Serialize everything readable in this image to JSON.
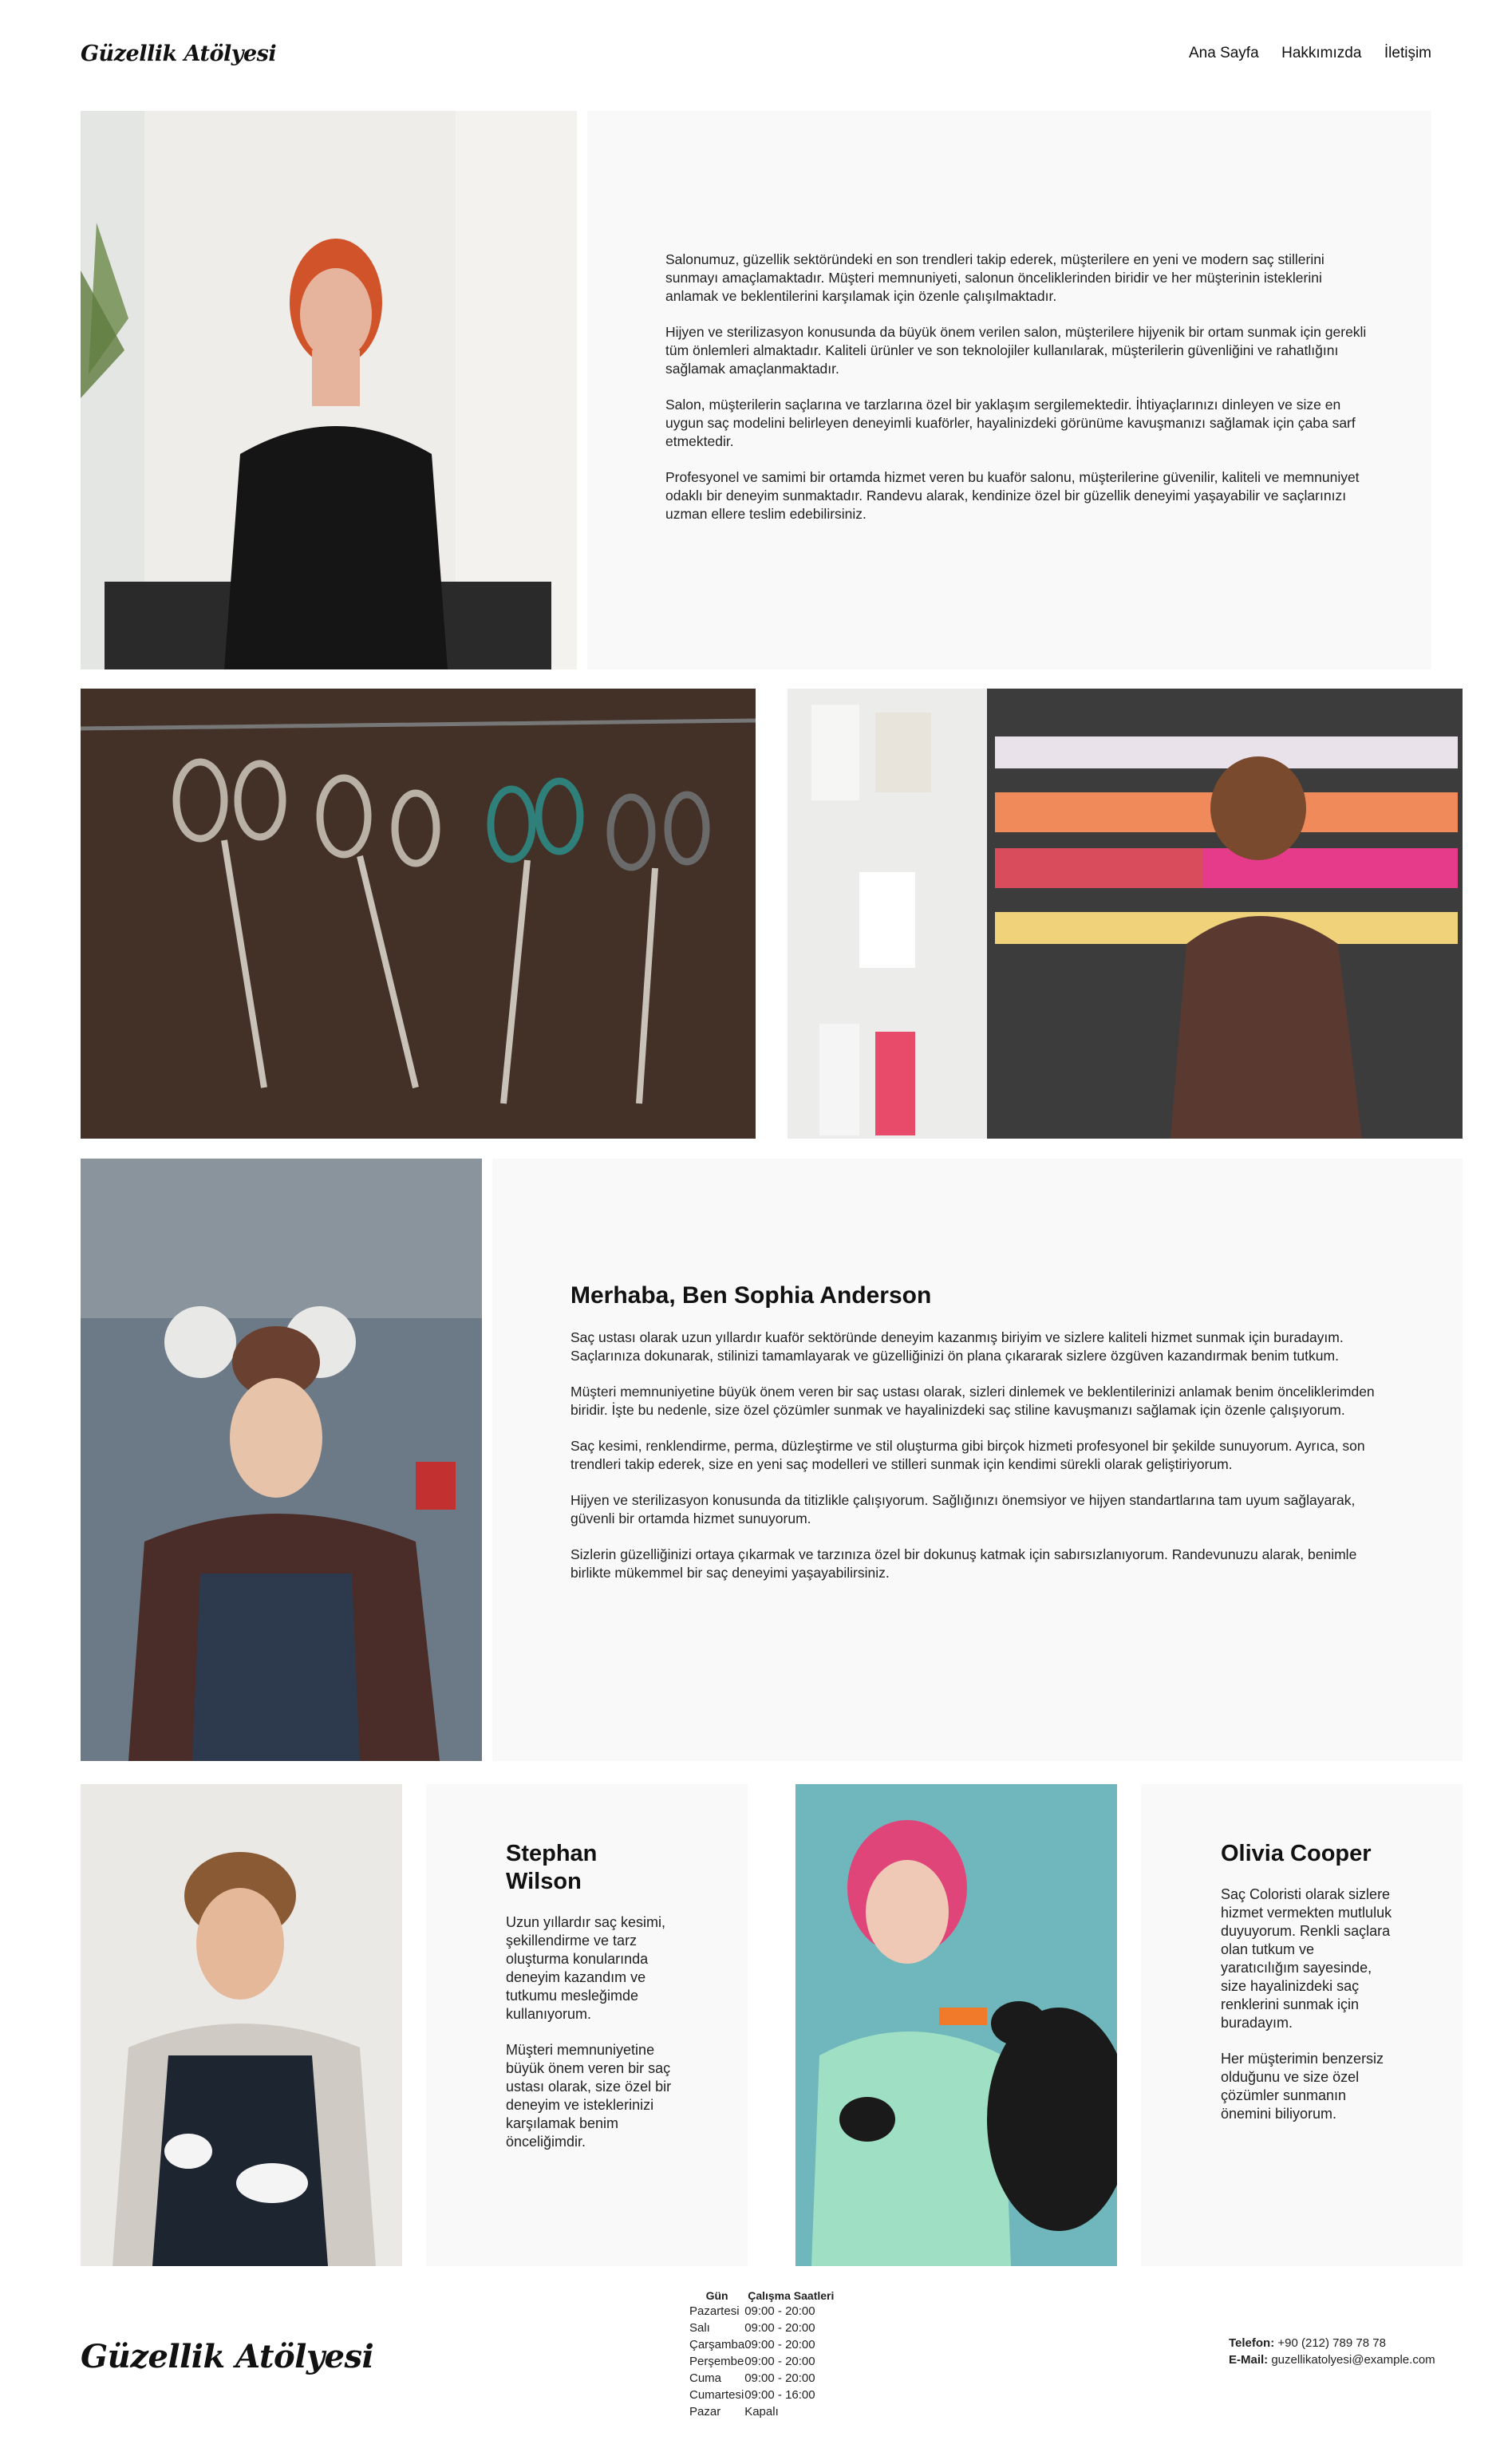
{
  "brand": {
    "name": "Güzellik Atölyesi"
  },
  "nav": {
    "home": "Ana Sayfa",
    "about": "Hakkımızda",
    "contact": "İletişim"
  },
  "intro": {
    "paragraphs": [
      "Salonumuz, güzellik sektöründeki en son trendleri takip ederek, müşterilere en yeni ve modern saç stillerini sunmayı amaçlamaktadır. Müşteri memnuniyeti, salonun önceliklerinden biridir ve her müşterinin isteklerini anlamak ve beklentilerini karşılamak için özenle çalışılmaktadır.",
      "Hijyen ve sterilizasyon konusunda da büyük önem verilen salon, müşterilere hijyenik bir ortam sunmak için gerekli tüm önlemleri almaktadır. Kaliteli ürünler ve son teknolojiler kullanılarak, müşterilerin güvenliğini ve rahatlığını sağlamak amaçlanmaktadır.",
      "Salon, müşterilerin saçlarına ve tarzlarına özel bir yaklaşım sergilemektedir. İhtiyaçlarınızı dinleyen ve size en uygun saç modelini belirleyen deneyimli kuaförler, hayalinizdeki görünüme kavuşmanızı sağlamak için çaba sarf etmektedir.",
      "Profesyonel ve samimi bir ortamda hizmet veren bu kuaför salonu, müşterilerine güvenilir, kaliteli ve memnuniyet odaklı bir deneyim sunmaktadır. Randevu alarak, kendinize özel bir güzellik deneyimi yaşayabilir ve saçlarınızı uzman ellere teslim edebilirsiniz."
    ]
  },
  "sophia": {
    "heading": "Merhaba, Ben Sophia Anderson",
    "paragraphs": [
      "Saç ustası olarak uzun yıllardır kuaför sektöründe deneyim kazanmış biriyim ve sizlere kaliteli hizmet sunmak için buradayım. Saçlarınıza dokunarak, stilinizi tamamlayarak ve güzelliğinizi ön plana çıkararak sizlere özgüven kazandırmak benim tutkum.",
      "Müşteri memnuniyetine büyük önem veren bir saç ustası olarak, sizleri dinlemek ve beklentilerinizi anlamak benim önceliklerimden biridir. İşte bu nedenle, size özel çözümler sunmak ve hayalinizdeki saç stiline kavuşmanızı sağlamak için özenle çalışıyorum.",
      "Saç kesimi, renklendirme, perma, düzleştirme ve stil oluşturma gibi birçok hizmeti profesyonel bir şekilde sunuyorum. Ayrıca, son trendleri takip ederek, size en yeni saç modelleri ve stilleri sunmak için kendimi sürekli olarak geliştiriyorum.",
      "Hijyen ve sterilizasyon konusunda da titizlikle çalışıyorum. Sağlığınızı önemsiyor ve hijyen standartlarına tam uyum sağlayarak, güvenli bir ortamda hizmet sunuyorum.",
      "Sizlerin güzelliğinizi ortaya çıkarmak ve tarzınıza özel bir dokunuş katmak için sabırsızlanıyorum. Randevunuzu alarak, benimle birlikte mükemmel bir saç deneyimi yaşayabilirsiniz."
    ]
  },
  "stephan": {
    "heading": "Stephan Wilson",
    "paragraphs": [
      "Uzun yıllardır saç kesimi, şekillendirme ve tarz oluşturma konularında deneyim kazandım ve tutkumu mesleğimde kullanıyorum.",
      "Müşteri memnuniyetine büyük önem veren bir saç ustası olarak, size özel bir deneyim ve isteklerinizi karşılamak benim önceliğimdir."
    ]
  },
  "olivia": {
    "heading": "Olivia Cooper",
    "paragraphs": [
      "Saç Coloristi olarak sizlere hizmet vermekten mutluluk duyuyorum. Renkli saçlara olan tutkum ve yaratıcılığım sayesinde, size hayalinizdeki saç renklerini sunmak için buradayım.",
      "Her müşterimin benzersiz olduğunu ve size özel çözümler sunmanın önemini biliyorum."
    ]
  },
  "hours": {
    "col_day": "Gün",
    "col_hours": "Çalışma Saatleri",
    "rows": [
      {
        "day": "Pazartesi",
        "time": "09:00 - 20:00"
      },
      {
        "day": "Salı",
        "time": "09:00 - 20:00"
      },
      {
        "day": "Çarşamba",
        "time": "09:00 - 20:00"
      },
      {
        "day": "Perşembe",
        "time": "09:00 - 20:00"
      },
      {
        "day": "Cuma",
        "time": "09:00 - 20:00"
      },
      {
        "day": "Cumartesi",
        "time": "09:00 - 16:00"
      },
      {
        "day": "Pazar",
        "time": "Kapalı"
      }
    ]
  },
  "contact": {
    "phone_label": "Telefon:",
    "phone": "+90 (212) 789 78 78",
    "email_label": "E-Mail:",
    "email": "guzellikatolyesi@example.com"
  },
  "photos": [
    "hairdresser-portrait-photo",
    "scissors-photo",
    "hair-dye-shelf-photo",
    "sophia-anderson-photo",
    "stephan-wilson-photo",
    "olivia-cooper-photo"
  ]
}
